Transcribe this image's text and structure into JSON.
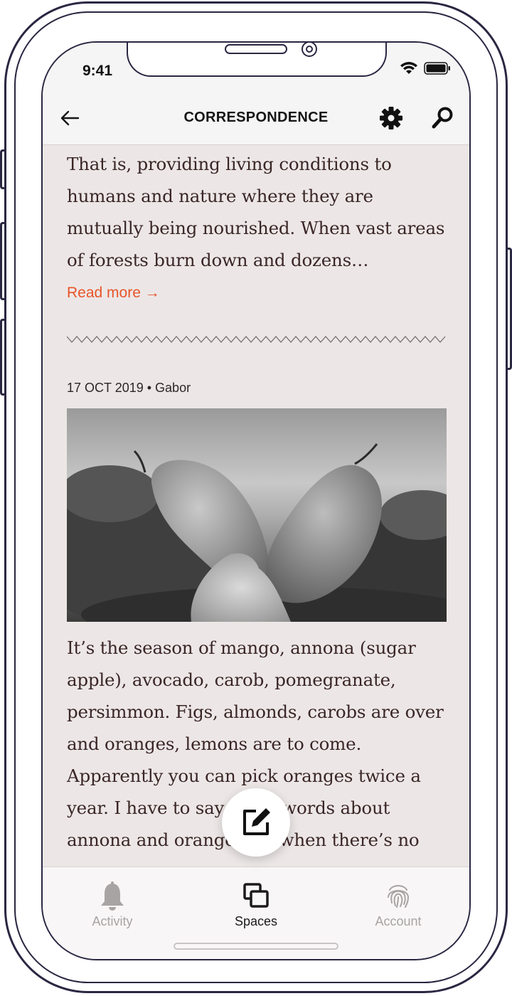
{
  "status_bar": {
    "time": "9:41"
  },
  "header": {
    "title": "CORRESPONDENCE"
  },
  "post_one": {
    "excerpt": "That is, providing living conditions to humans and nature where they are mutually being nourished. When vast areas of forests burn down and dozens…",
    "read_more": "Read more →"
  },
  "post_two": {
    "meta": "17 OCT 2019 • Gabor",
    "body": "It’s the season of mango, annona (sugar apple), avocado, carob, pomegranate, persimmon. Figs, almonds, carobs are over and oranges, lemons are to come. Apparently you can pick oranges twice a year. I have to say a few words about annona and oranges, so when there’s no"
  },
  "tabbar": {
    "items": [
      {
        "label": "Activity",
        "icon": "bell-icon",
        "active": false
      },
      {
        "label": "Spaces",
        "icon": "spaces-icon",
        "active": true
      },
      {
        "label": "Account",
        "icon": "fingerprint-icon",
        "active": false
      }
    ]
  },
  "colors": {
    "accent": "#e8542a",
    "content_bg": "#ece7e6",
    "text": "#3a2626",
    "frame": "#2a2742"
  }
}
